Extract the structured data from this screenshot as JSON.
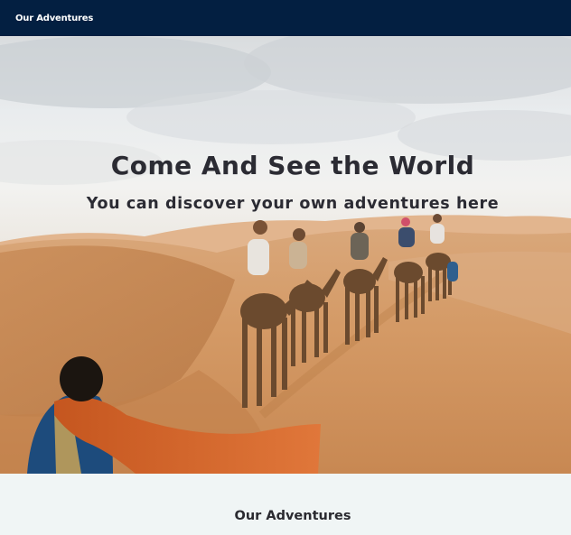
{
  "navbar": {
    "brand_link": "Our Adventures",
    "background": "#031f41"
  },
  "hero": {
    "title": "Come And See the World",
    "subtitle": "You can discover your own adventures here",
    "image_description_icon": "desert-camel-caravan-photo"
  },
  "section": {
    "title": "Our Adventures",
    "background": "#f0f5f5"
  }
}
